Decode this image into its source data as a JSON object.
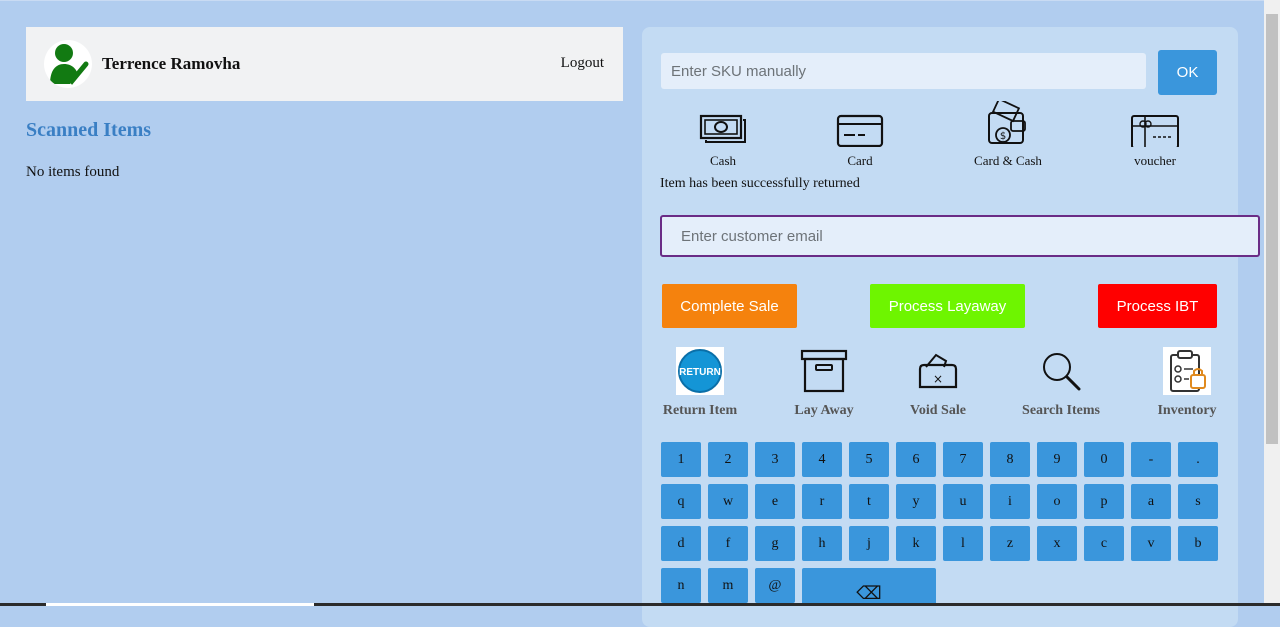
{
  "user": {
    "name": "Terrence Ramovha",
    "logout_label": "Logout"
  },
  "scanned": {
    "title": "Scanned Items",
    "empty_text": "No items found"
  },
  "sku": {
    "placeholder": "Enter SKU manually",
    "ok_label": "OK"
  },
  "payment_methods": [
    {
      "label": "Cash",
      "icon": "cash-icon"
    },
    {
      "label": "Card",
      "icon": "card-icon"
    },
    {
      "label": "Card & Cash",
      "icon": "card-and-cash-icon"
    },
    {
      "label": "voucher",
      "icon": "voucher-icon"
    }
  ],
  "status_message": "Item has been successfully returned",
  "customer": {
    "email_placeholder": "Enter customer email"
  },
  "actions": [
    {
      "label": "Complete Sale",
      "color": "#f5820d"
    },
    {
      "label": "Process Layaway",
      "color": "#6ef500"
    },
    {
      "label": "Process IBT",
      "color": "#ff0000"
    }
  ],
  "tools": [
    {
      "label": "Return Item",
      "icon": "return-icon",
      "badge": "RETURN"
    },
    {
      "label": "Lay Away",
      "icon": "archive-box-icon"
    },
    {
      "label": "Void Sale",
      "icon": "void-wallet-icon"
    },
    {
      "label": "Search Items",
      "icon": "search-icon"
    },
    {
      "label": "Inventory",
      "icon": "clipboard-icon"
    }
  ],
  "keyboard": {
    "row1": [
      "1",
      "2",
      "3",
      "4",
      "5",
      "6",
      "7",
      "8",
      "9",
      "0",
      "-",
      "."
    ],
    "row2": [
      "q",
      "w",
      "e",
      "r",
      "t",
      "y",
      "u",
      "i",
      "o",
      "p",
      "a",
      "s"
    ],
    "row3": [
      "d",
      "f",
      "g",
      "h",
      "j",
      "k",
      "l",
      "z",
      "x",
      "c",
      "v",
      "b"
    ],
    "row4": [
      "n",
      "m",
      "@"
    ],
    "backspace": "⌫"
  },
  "colors": {
    "accent": "#3a96dc",
    "background": "#b1cdef",
    "panel": "#c3dbf3",
    "title": "#3a7fc4"
  }
}
